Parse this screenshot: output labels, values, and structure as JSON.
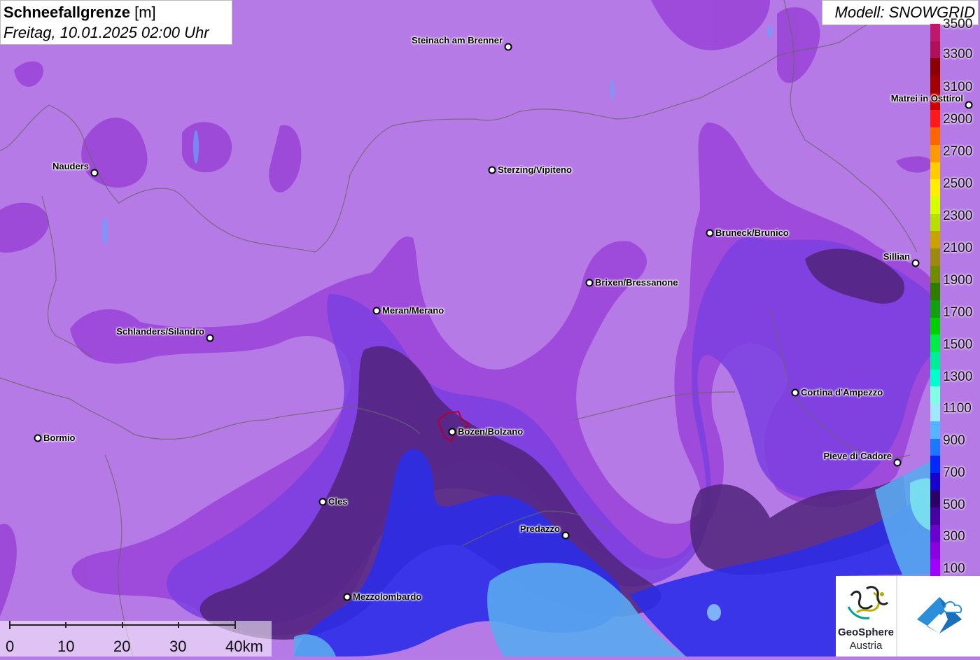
{
  "title": {
    "parameter": "Schneefallgrenze",
    "unit": "[m]",
    "datetime": "Freitag, 10.01.2025 02:00 Uhr"
  },
  "model": {
    "label": "Modell: SNOWGRID"
  },
  "legend": {
    "labels": [
      "3500",
      "3300",
      "3100",
      "2900",
      "2700",
      "2500",
      "2300",
      "2100",
      "1900",
      "1700",
      "1500",
      "1300",
      "1100",
      "900",
      "700",
      "500",
      "300",
      "100"
    ],
    "colors": [
      "#c2186b",
      "#b0105a",
      "#8b0000",
      "#a30000",
      "#cc0000",
      "#ff1a1a",
      "#ff6600",
      "#ff9900",
      "#ffcc00",
      "#ffee00",
      "#d7ff00",
      "#b5e000",
      "#c8a200",
      "#9c8a10",
      "#6f8c00",
      "#2e7d00",
      "#10a010",
      "#00d000",
      "#00ee44",
      "#00ee99",
      "#00ffcc",
      "#7fffe6",
      "#9fe8ff",
      "#56b4ff",
      "#1e78ff",
      "#0028ff",
      "#1a00cc",
      "#2c0066",
      "#4a00a0",
      "#6a00d0",
      "#8a00e0",
      "#a000ff"
    ]
  },
  "cities": [
    {
      "name": "Steinach am Brenner",
      "side": "left"
    },
    {
      "name": "Matrei in Osttirol",
      "side": "left"
    },
    {
      "name": "Nauders",
      "side": "left"
    },
    {
      "name": "Sterzing/Vipiteno",
      "side": "right"
    },
    {
      "name": "Bruneck/Brunico",
      "side": "right"
    },
    {
      "name": "Sillian",
      "side": "left"
    },
    {
      "name": "Brixen/Bressanone",
      "side": "right"
    },
    {
      "name": "Meran/Merano",
      "side": "right"
    },
    {
      "name": "Schlanders/Silandro",
      "side": "left"
    },
    {
      "name": "Cortina d'Ampezzo",
      "side": "right"
    },
    {
      "name": "Bormio",
      "side": "right"
    },
    {
      "name": "Bozen/Bolzano",
      "side": "right"
    },
    {
      "name": "Pieve di Cadore",
      "side": "left"
    },
    {
      "name": "Cles",
      "side": "right"
    },
    {
      "name": "Predazzo",
      "side": "left"
    },
    {
      "name": "Mezzolombardo",
      "side": "right"
    }
  ],
  "scale_bar": {
    "labels": [
      "0",
      "10",
      "20",
      "30",
      "40km"
    ]
  },
  "logos": {
    "geosphere_name": "GeoSphere",
    "geosphere_country": "Austria"
  }
}
